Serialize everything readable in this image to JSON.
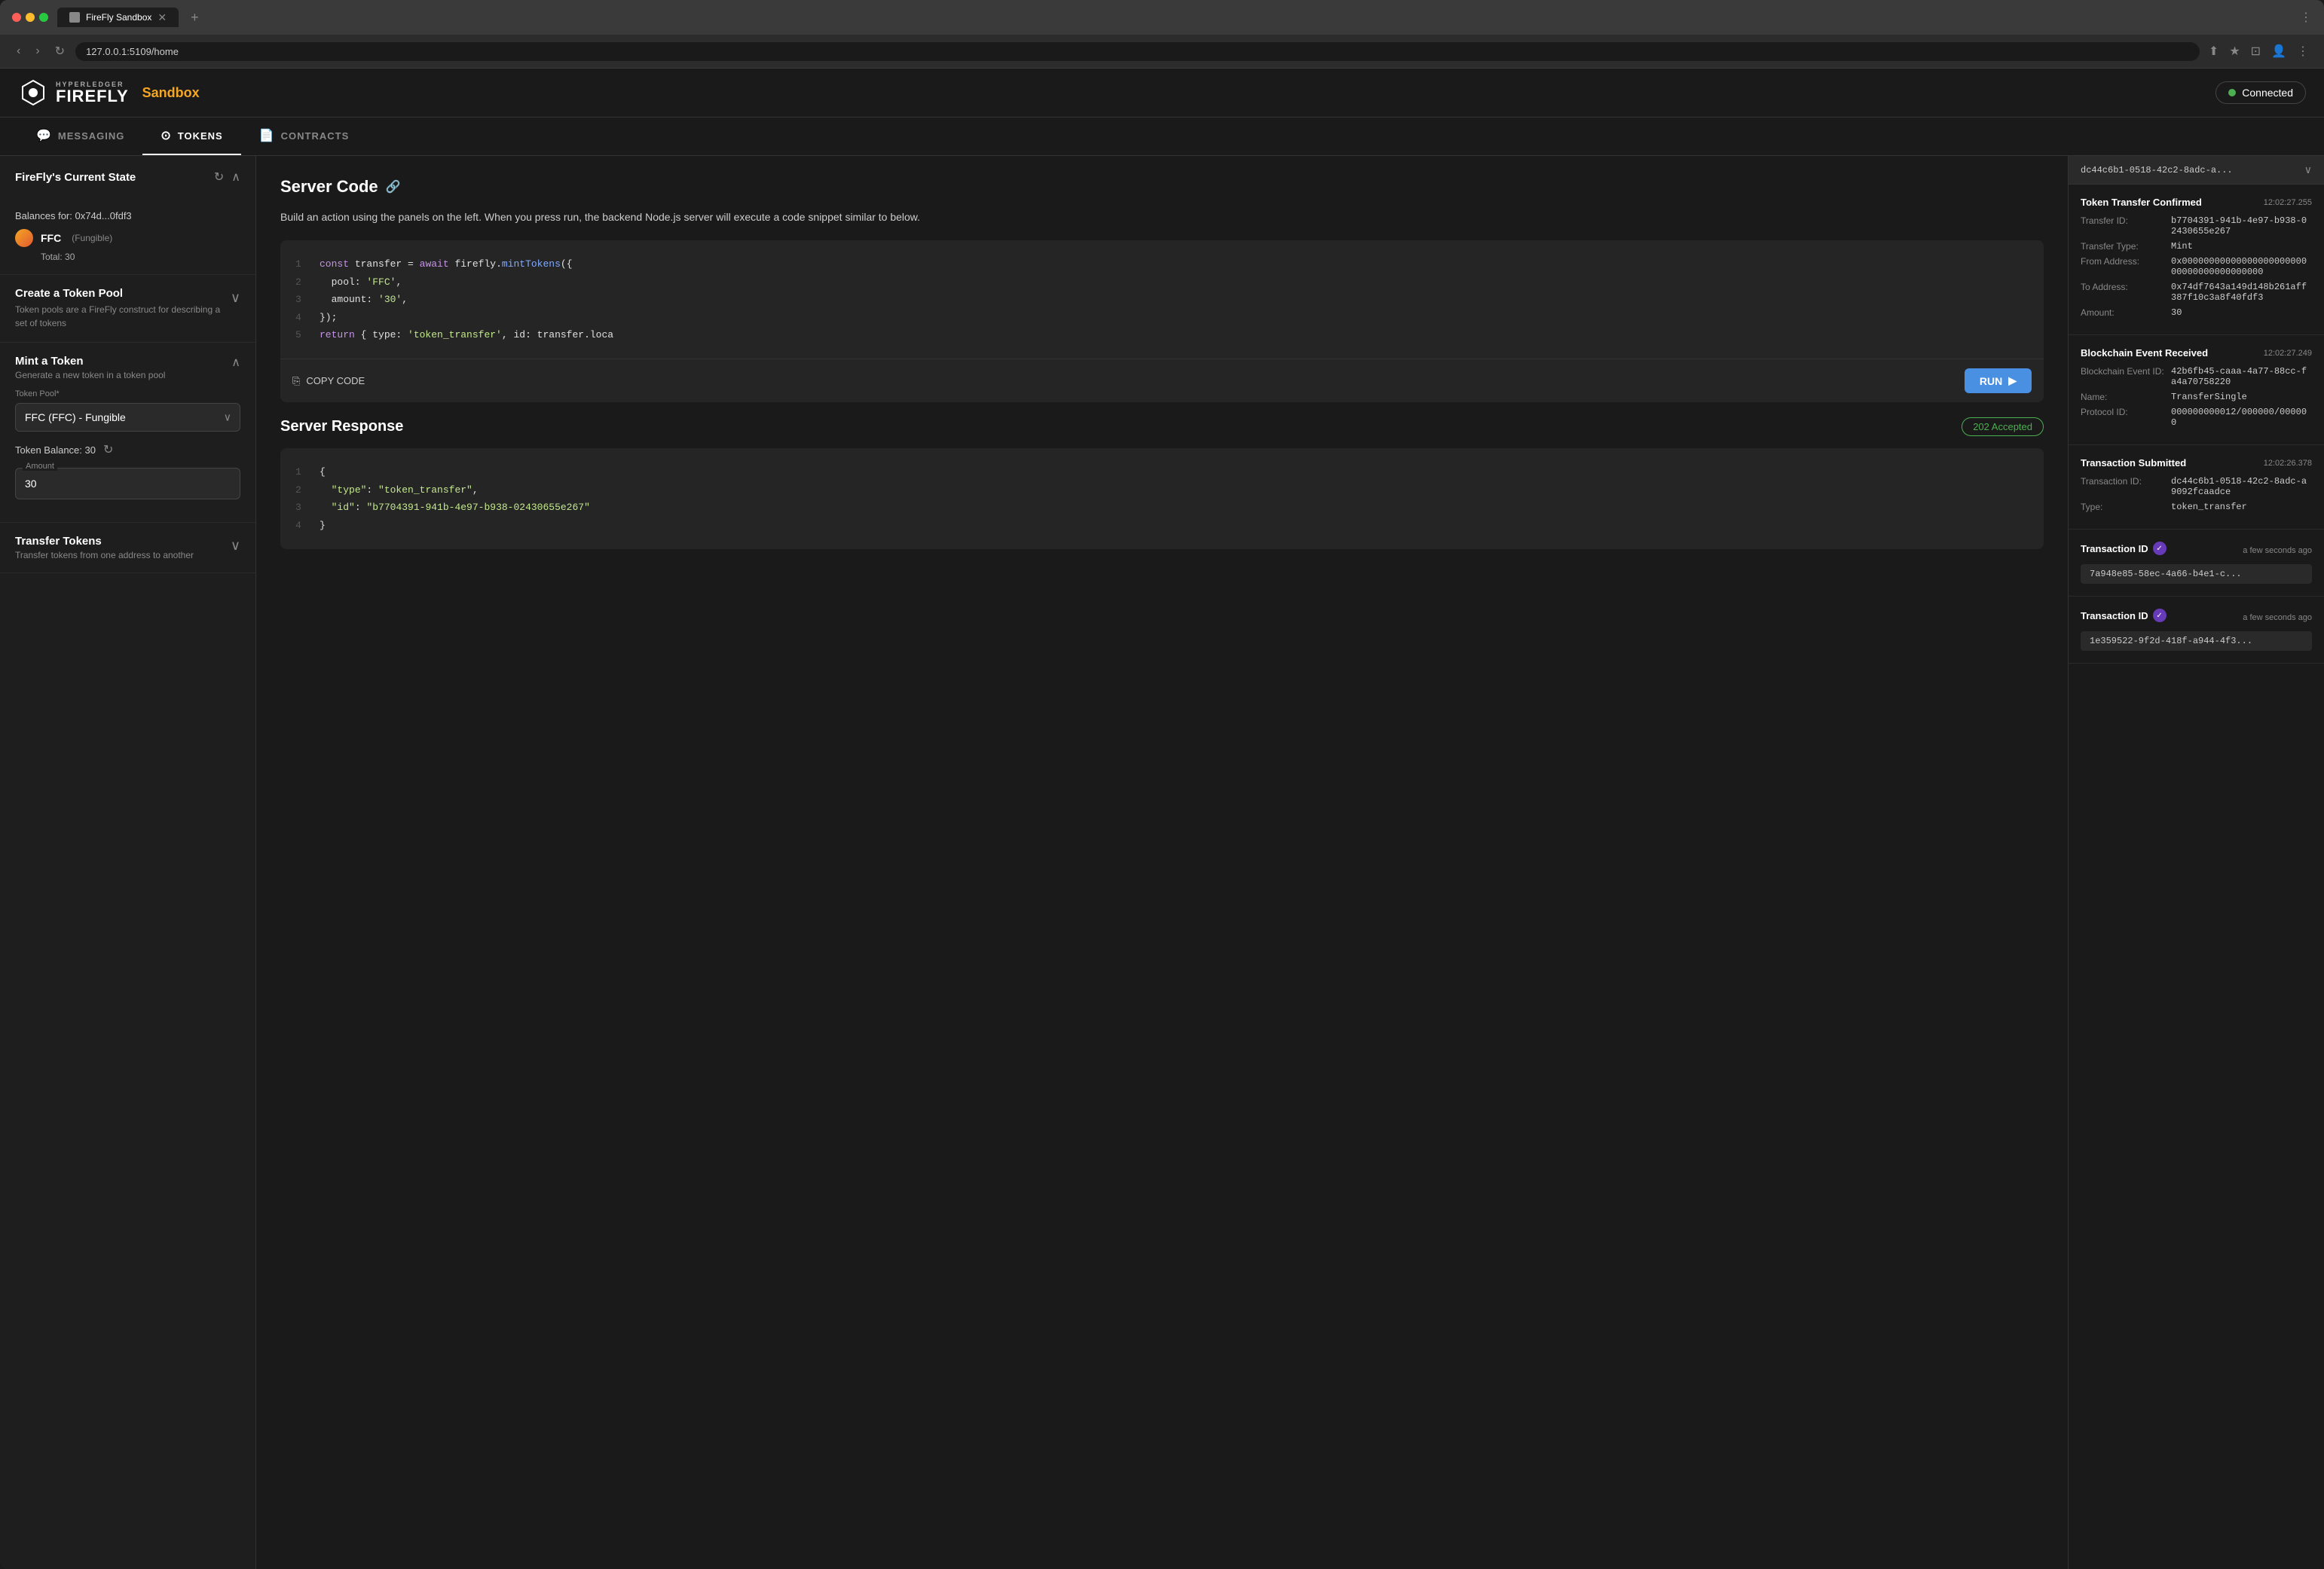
{
  "browser": {
    "tab_label": "FireFly Sandbox",
    "url": "127.0.0.1:5109/home",
    "new_tab_icon": "+"
  },
  "header": {
    "hyperledger_label": "HYPERLEDGER",
    "firefly_label": "FIREFLY",
    "sandbox_label": "Sandbox",
    "connected_label": "Connected"
  },
  "nav": {
    "tabs": [
      {
        "id": "messaging",
        "label": "MESSAGING",
        "icon": "💬"
      },
      {
        "id": "tokens",
        "label": "TOKENS",
        "icon": "⊙",
        "active": true
      },
      {
        "id": "contracts",
        "label": "CONTRACTS",
        "icon": "📄"
      }
    ]
  },
  "sidebar": {
    "current_state": {
      "title": "FireFly's Current State",
      "balances_label": "Balances for: 0x74d...0fdf3",
      "token": {
        "name": "FFC",
        "type": "(Fungible)",
        "total_label": "Total: 30"
      }
    },
    "create_pool": {
      "title": "Create a Token Pool",
      "description": "Token pools are a FireFly construct for describing a set of tokens"
    },
    "mint": {
      "title": "Mint a Token",
      "description": "Generate a new token in a token pool",
      "token_pool_label": "Token Pool*",
      "token_pool_value": "FFC (FFC) - Fungible",
      "token_balance_label": "Token Balance: 30",
      "amount_label": "Amount",
      "amount_value": "30"
    },
    "transfer": {
      "title": "Transfer Tokens",
      "description": "Transfer tokens from one address to another"
    }
  },
  "main": {
    "server_code": {
      "title": "Server Code",
      "description": "Build an action using the panels on the left. When you press run, the backend Node.js server will execute a code snippet similar to below.",
      "code_lines": [
        {
          "num": "1",
          "text": "const transfer = await firefly.mintTokens({"
        },
        {
          "num": "2",
          "text": "  pool: 'FFC',"
        },
        {
          "num": "3",
          "text": "  amount: '30',"
        },
        {
          "num": "4",
          "text": "});"
        },
        {
          "num": "5",
          "text": "return { type: 'token_transfer', id: transfer.loca"
        }
      ],
      "copy_btn_label": "COPY CODE",
      "run_btn_label": "RUN"
    },
    "server_response": {
      "title": "Server Response",
      "status_badge": "202 Accepted",
      "response_lines": [
        {
          "num": "1",
          "text": "{"
        },
        {
          "num": "2",
          "text": "  \"type\": \"token_transfer\","
        },
        {
          "num": "3",
          "text": "  \"id\": \"b7704391-941b-4e97-b938-02430655e267\""
        },
        {
          "num": "4",
          "text": "}"
        }
      ]
    }
  },
  "right_panel": {
    "top_id": "dc44c6b1-0518-42c2-8adc-a...",
    "events": [
      {
        "type": "token_transfer_confirmed",
        "title": "Token Transfer Confirmed",
        "timestamp": "12:02:27.255",
        "rows": [
          {
            "key": "Transfer ID:",
            "value": "b7704391-941b-4e97-b938-02430655e267"
          },
          {
            "key": "Transfer Type:",
            "value": "Mint"
          },
          {
            "key": "From Address:",
            "value": "0x0000000000000000000000000000000000000000"
          },
          {
            "key": "To Address:",
            "value": "0x74df7643a149d148b261aff387f10c3a8f40fdf3"
          },
          {
            "key": "Amount:",
            "value": "30"
          }
        ]
      },
      {
        "type": "blockchain_event",
        "title": "Blockchain Event Received",
        "timestamp": "12:02:27.249",
        "rows": [
          {
            "key": "Blockchain Event ID:",
            "value": "42b6fb45-caaa-4a77-88cc-fa4a70758220"
          },
          {
            "key": "Name:",
            "value": "TransferSingle"
          },
          {
            "key": "Protocol ID:",
            "value": "000000000012/000000/000000"
          }
        ]
      },
      {
        "type": "transaction_submitted",
        "title": "Transaction Submitted",
        "timestamp": "12:02:26.378",
        "rows": [
          {
            "key": "Transaction ID:",
            "value": "dc44c6b1-0518-42c2-8adc-a9092fcaadce"
          },
          {
            "key": "Type:",
            "value": "token_transfer"
          }
        ]
      },
      {
        "type": "transaction_id_1",
        "title": "Transaction ID",
        "time_label": "a few seconds ago",
        "chip": "7a948e85-58ec-4a66-b4e1-c..."
      },
      {
        "type": "transaction_id_2",
        "title": "Transaction ID",
        "time_label": "a few seconds ago",
        "chip": "1e359522-9f2d-418f-a944-4f3..."
      }
    ]
  }
}
